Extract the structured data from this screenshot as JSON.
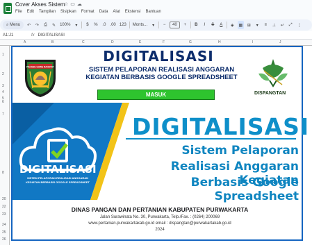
{
  "app": {
    "doc_title": "Cover Akses Sistem",
    "title_icons": [
      "star-icon",
      "folder-icon",
      "cloud-icon"
    ]
  },
  "menubar": [
    "File",
    "Edit",
    "Tampilan",
    "Sisipkan",
    "Format",
    "Data",
    "Alat",
    "Ekstensi",
    "Bantuan"
  ],
  "toolbar": {
    "menu_label": "Menu",
    "zoom": "100%",
    "currency": "$",
    "percent": "%",
    "decimal_dec": ".0",
    "decimal_inc": ".00",
    "number_format": "123",
    "font": "Monts...",
    "font_size": "40",
    "bold": "B",
    "italic": "I",
    "strike": "S",
    "text_color": "A"
  },
  "formula_bar": {
    "name_box": "A1:J1",
    "fx": "fx",
    "content": "DIGITALISASI"
  },
  "columns": [
    "A",
    "B",
    "C",
    "D",
    "E",
    "F",
    "G",
    "H",
    "I",
    "J"
  ],
  "rows": [
    "1",
    "2",
    "3",
    "4",
    "5",
    "6",
    "7",
    "8",
    "20",
    "22",
    "23",
    "24",
    "25",
    "26"
  ],
  "cover": {
    "title": "DIGITALISASI",
    "subtitle1": "SISTEM PELAPORAN REALISASI ANGGARAN",
    "subtitle2": "KEGIATAN BERBASIS GOOGLE SPREADSHEET",
    "button": "MASUK",
    "logo_right_label": "DISPANGTAN",
    "emblem_text": "PAHADE GAWE RAHAYAT"
  },
  "banner": {
    "title": "DIGITALISASI",
    "line1": "Sistem Pelaporan",
    "line2": "Realisasi Anggaran Kegiatan",
    "line3": "Berbasis Google Spreadsheet",
    "cloud_title": "DIGITALISASI",
    "cloud_sub1": "SISTEM PELAPORAN REALISASI ANGGARAN",
    "cloud_sub2": "KEGIATAN BERBASIS GOOGLE SPREADSHEET"
  },
  "footer": {
    "org": "DINAS PANGAN DAN PERTANIAN KABUPATEN PURWAKARTA",
    "address": "Jalan Surawinata No. 30, Purwakarta, Telp./Fax. : (0264) 200069",
    "web": "www.pertanian.purwakartakab.go.id  email : dispangtan@purwakartakab.go.id",
    "year": "2024"
  },
  "colors": {
    "accent_blue": "#0e8fc9",
    "navy": "#0d2d6c",
    "button_green": "#2ec42e",
    "banner_yellow": "#f2c318"
  }
}
